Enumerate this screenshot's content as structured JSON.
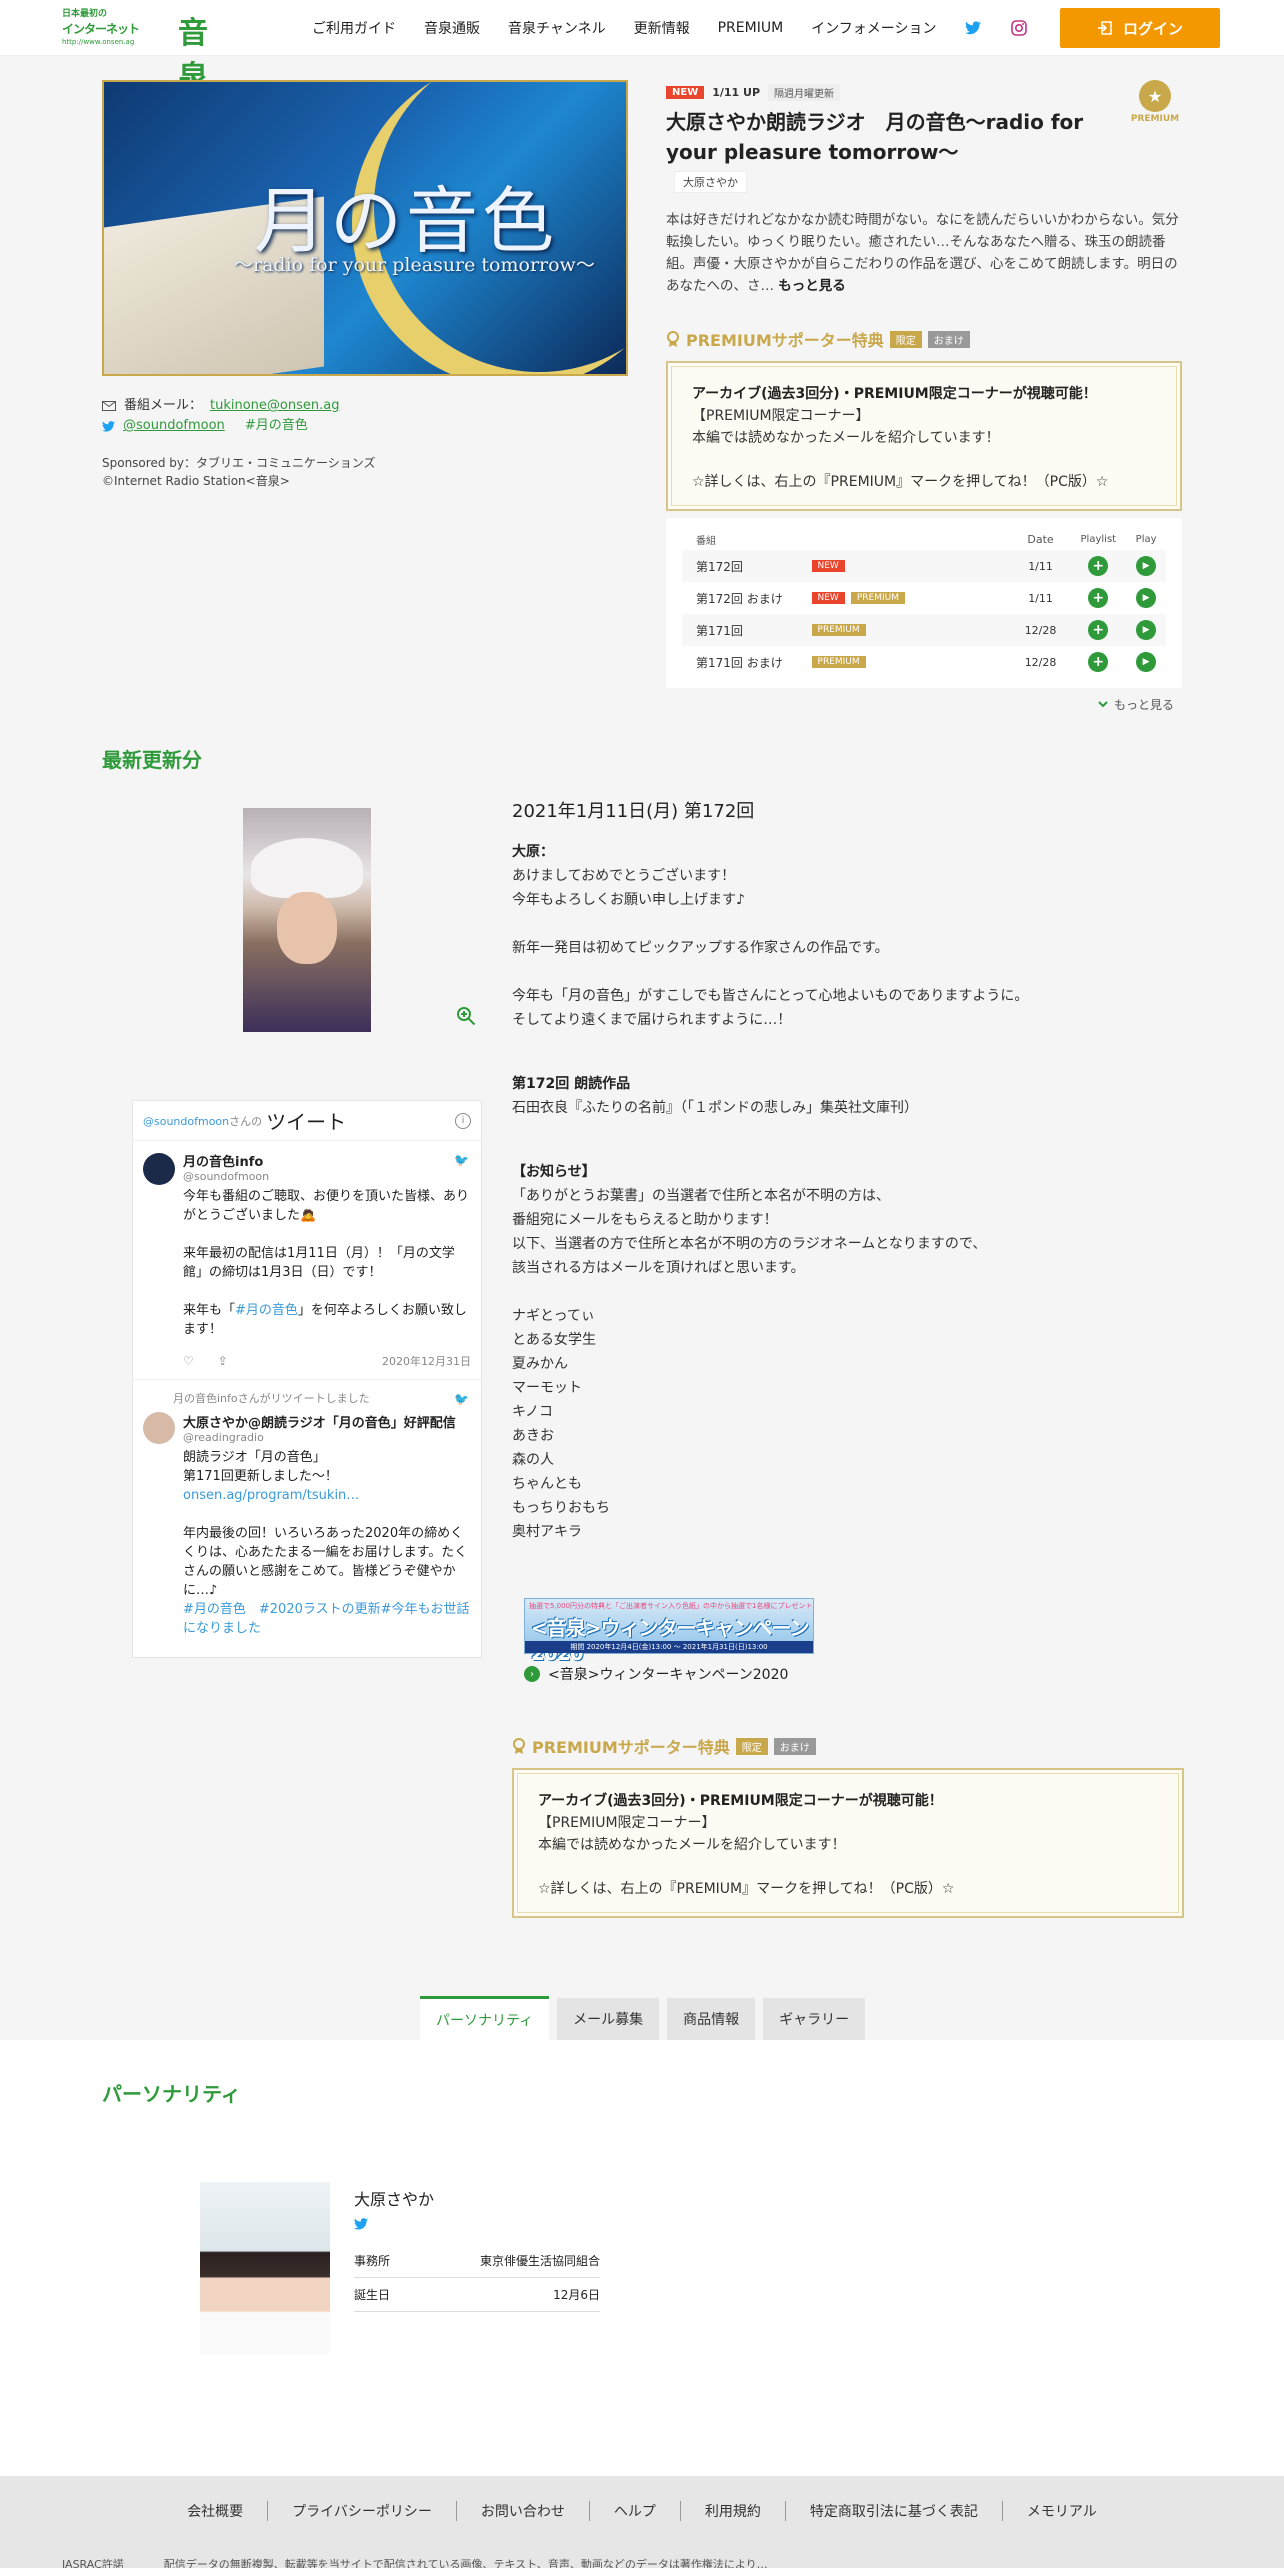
{
  "header": {
    "logo": {
      "line1": "日本最初の",
      "line2": "インターネット",
      "line3": "http://www.onsen.ag",
      "big": "音泉"
    },
    "nav": [
      "ご利用ガイド",
      "音泉通販",
      "音泉チャンネル",
      "更新情報",
      "PREMIUM",
      "インフォメーション"
    ],
    "login_label": "ログイン"
  },
  "program": {
    "hero_title": "月の音色",
    "hero_subtitle": "〜radio for your pleasure tomorrow〜",
    "mail_label": "番組メール：",
    "mail": "tukinone@onsen.ag",
    "twitter_handle": "@soundofmoon",
    "hashtag": "#月の音色",
    "sponsor": "Sponsored by：タブリエ・コミュニケーションズ",
    "copyright": "©Internet Radio Station<音泉>",
    "tag_new": "NEW",
    "tag_update": "1/11 UP",
    "tag_schedule": "隔週月曜更新",
    "title": "大原さやか朗読ラジオ　月の音色〜radio for your pleasure tomorrow〜",
    "personality_chip": "大原さやか",
    "description": "本は好きだけれどなかなか読む時間がない。なにを読んだらいいかわからない。気分転換したい。ゆっくり眠りたい。癒されたい…そんなあなたへ贈る、珠玉の朗読番組。声優・大原さやかが自らこだわりの作品を選び、心をこめて朗読します。明日のあなたへの、さ…",
    "more_link": "もっと見る",
    "premium_badge": "PREMIUM"
  },
  "supporter": {
    "heading": "PREMIUMサポーター特典",
    "tag1": "限定",
    "tag2": "おまけ",
    "line1": "アーカイブ(過去3回分)・PREMIUM限定コーナーが視聴可能！",
    "line2": "【PREMIUM限定コーナー】",
    "line3": "本編では読めなかったメールを紹介しています！",
    "line4": "☆詳しくは、右上の『PREMIUM』マークを押してね！（PC版）☆"
  },
  "episodes": {
    "headers": {
      "name": "番組",
      "date": "Date",
      "playlist": "Playlist",
      "play": "Play"
    },
    "rows": [
      {
        "name": "第172回",
        "tags": [
          "NEW"
        ],
        "date": "1/11"
      },
      {
        "name": "第172回 おまけ",
        "tags": [
          "NEW",
          "PREMIUM"
        ],
        "date": "1/11"
      },
      {
        "name": "第171回",
        "tags": [
          "PREMIUM"
        ],
        "date": "12/28"
      },
      {
        "name": "第171回 おまけ",
        "tags": [
          "PREMIUM"
        ],
        "date": "12/28"
      }
    ],
    "more": "もっと見る"
  },
  "latest": {
    "heading": "最新更新分",
    "date": "2021年1月11日(月) 第172回",
    "block1_label": "大原：",
    "block1": "あけましておめでとうございます！\n今年もよろしくお願い申し上げます♪",
    "block2": "新年一発目は初めてピックアップする作家さんの作品です。",
    "block3": "今年も「月の音色」がすこしでも皆さんにとって心地よいものでありますように。\nそしてより遠くまで届けられますように…！",
    "block4_label": "第172回 朗読作品",
    "block4": "石田衣良『ふたりの名前』（「１ポンドの悲しみ」集英社文庫刊）",
    "block5_label": "【お知らせ】",
    "block5": "「ありがとうお葉書」の当選者で住所と本名が不明の方は、\n番組宛にメールをもらえると助かります！\n以下、当選者の方で住所と本名が不明の方のラジオネームとなりますので、\n該当される方はメールを頂ければと思います。",
    "names": "ナギとってぃ\nとある女学生\n夏みかん\nマーモット\nキノコ\nあきお\n森の人\nちゃんとも\nもっちりおもち\n奥村アキラ",
    "banner_top": "抽選で5,000円分の特典と「ご出演者サイン入り色紙」の中から抽選で1名様にプレゼント",
    "banner_main": "<音泉>ウィンターキャンペーン2020",
    "banner_period": "期間 2020年12月4日(金)13:00 〜 2021年1月31日(日)13:00",
    "campaign_link": "<音泉>ウィンターキャンペーン2020"
  },
  "tweets": {
    "header_handle": "@soundofmoon",
    "header_suffix": "さんの",
    "header_title": "ツイート",
    "t1": {
      "name": "月の音色info",
      "handle": "@soundofmoon",
      "text1": "今年も番組のご聴取、お便りを頂いた皆様、ありがとうございました🙇",
      "text2": "来年最初の配信は1月11日（月）！「月の文学館」の締切は1月3日（日）です！",
      "text3_pre": "来年も「",
      "text3_tag": "#月の音色",
      "text3_post": "」を何卒よろしくお願い致します！",
      "date": "2020年12月31日"
    },
    "t2": {
      "retweet_line": "月の音色infoさんがリツイートしました",
      "name": "大原さやか@朗読ラジオ「月の音色」好評配信",
      "handle": "@readingradio",
      "text1": "朗読ラジオ「月の音色」\n第171回更新しました〜！",
      "link": "onsen.ag/program/tsukin…",
      "text2": "年内最後の回！いろいろあった2020年の締めくくりは、心あたたまる一編をお届けします。たくさんの願いと感謝をこめて。皆様どうぞ健やかに…♪",
      "tags": "#月の音色　#2020ラストの更新#今年もお世話になりました"
    }
  },
  "supporter2": {
    "heading": "PREMIUMサポーター特典"
  },
  "tabs": [
    "パーソナリティ",
    "メール募集",
    "商品情報",
    "ギャラリー"
  ],
  "personality": {
    "heading": "パーソナリティ",
    "name": "大原さやか",
    "rows": [
      {
        "label": "事務所",
        "value": "東京俳優生活協同組合"
      },
      {
        "label": "誕生日",
        "value": "12月6日"
      }
    ]
  },
  "footer": {
    "links": [
      "会社概要",
      "プライバシーポリシー",
      "お問い合わせ",
      "ヘルプ",
      "利用規約",
      "特定商取引法に基づく表記",
      "メモリアル"
    ],
    "bottom1": "JASRAC許諾",
    "bottom2": "配信データの無断複製、転載等を当サイトで配信されている画像、テキスト、音声、動画などのデータは著作権法により…"
  },
  "colors": {
    "accent": "#2e9a3a",
    "login": "#f39800",
    "premium": "#c9a84b",
    "new": "#e8452c"
  }
}
